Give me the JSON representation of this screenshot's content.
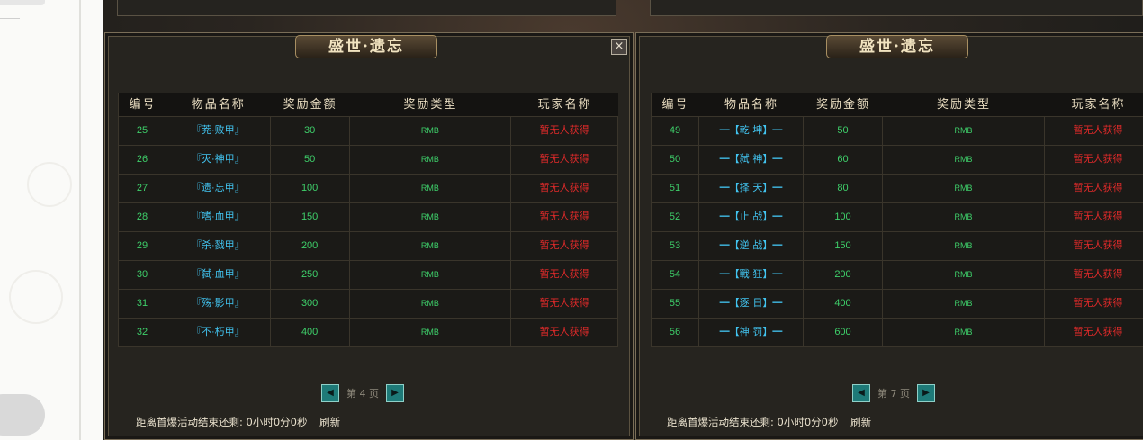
{
  "panels": [
    {
      "title": "盛世·遗忘",
      "close_glyph": "×",
      "headers": [
        "编号",
        "物品名称",
        "奖励金额",
        "奖励类型",
        "玩家名称"
      ],
      "rows": [
        {
          "id": "25",
          "name": "『茺·败甲』",
          "amount": "30",
          "type": "RMB",
          "player": "暂无人获得"
        },
        {
          "id": "26",
          "name": "『灭·神甲』",
          "amount": "50",
          "type": "RMB",
          "player": "暂无人获得"
        },
        {
          "id": "27",
          "name": "『遗·忘甲』",
          "amount": "100",
          "type": "RMB",
          "player": "暂无人获得"
        },
        {
          "id": "28",
          "name": "『嗜·血甲』",
          "amount": "150",
          "type": "RMB",
          "player": "暂无人获得"
        },
        {
          "id": "29",
          "name": "『杀·戮甲』",
          "amount": "200",
          "type": "RMB",
          "player": "暂无人获得"
        },
        {
          "id": "30",
          "name": "『弑·血甲』",
          "amount": "250",
          "type": "RMB",
          "player": "暂无人获得"
        },
        {
          "id": "31",
          "name": "『殇·影甲』",
          "amount": "300",
          "type": "RMB",
          "player": "暂无人获得"
        },
        {
          "id": "32",
          "name": "『不·朽甲』",
          "amount": "400",
          "type": "RMB",
          "player": "暂无人获得"
        }
      ],
      "pager": {
        "prev": "◀",
        "text": "第 4 页",
        "next": "▶"
      },
      "footer": {
        "countdown": "距离首爆活动结束还剩: 0小时0分0秒",
        "refresh": "刷新"
      }
    },
    {
      "title": "盛世·遗忘",
      "headers": [
        "编号",
        "物品名称",
        "奖励金额",
        "奖励类型",
        "玩家名称"
      ],
      "rows": [
        {
          "id": "49",
          "name": "━【乾·坤】━",
          "amount": "50",
          "type": "RMB",
          "player": "暂无人获得"
        },
        {
          "id": "50",
          "name": "━【弑·神】━",
          "amount": "60",
          "type": "RMB",
          "player": "暂无人获得"
        },
        {
          "id": "51",
          "name": "━【择·天】━",
          "amount": "80",
          "type": "RMB",
          "player": "暂无人获得"
        },
        {
          "id": "52",
          "name": "━【止·战】━",
          "amount": "100",
          "type": "RMB",
          "player": "暂无人获得"
        },
        {
          "id": "53",
          "name": "━【逆·战】━",
          "amount": "150",
          "type": "RMB",
          "player": "暂无人获得"
        },
        {
          "id": "54",
          "name": "━【戰·狂】━",
          "amount": "200",
          "type": "RMB",
          "player": "暂无人获得"
        },
        {
          "id": "55",
          "name": "━【逐·日】━",
          "amount": "400",
          "type": "RMB",
          "player": "暂无人获得"
        },
        {
          "id": "56",
          "name": "━【神·罚】━",
          "amount": "600",
          "type": "RMB",
          "player": "暂无人获得"
        }
      ],
      "pager": {
        "prev": "◀",
        "text": "第 7 页",
        "next": "▶"
      },
      "footer": {
        "countdown": "距离首爆活动结束还剩: 0小时0分0秒",
        "refresh": "刷新"
      }
    }
  ]
}
